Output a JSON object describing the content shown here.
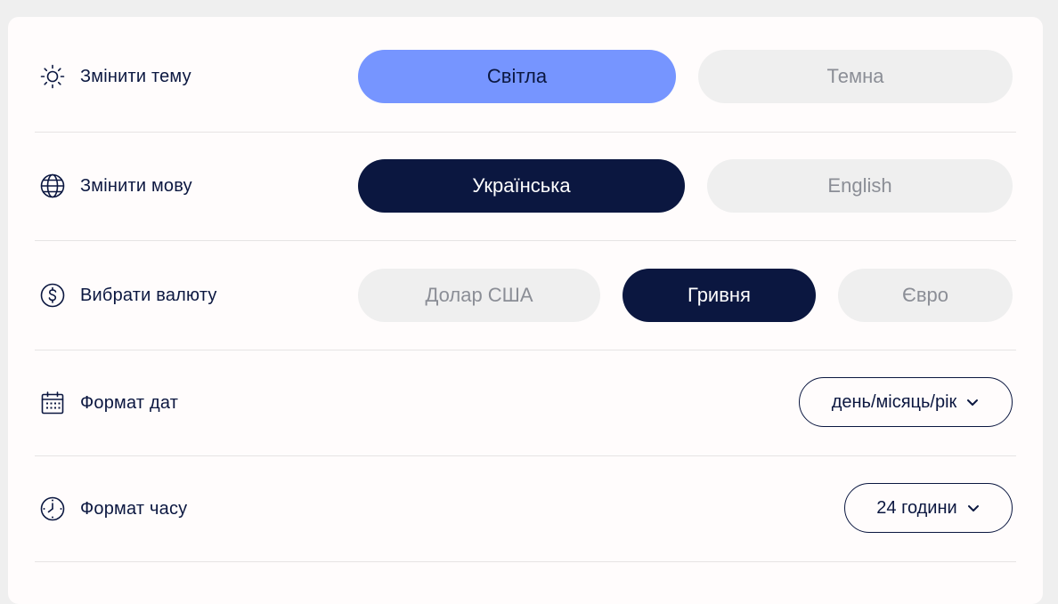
{
  "theme": {
    "label": "Змінити тему",
    "options": [
      "Світла",
      "Темна"
    ],
    "selected": "Світла"
  },
  "language": {
    "label": "Змінити мову",
    "options": [
      "Українська",
      "English"
    ],
    "selected": "Українська"
  },
  "currency": {
    "label": "Вибрати валюту",
    "options": [
      "Долар США",
      "Гривня",
      "Євро"
    ],
    "selected": "Гривня"
  },
  "date_format": {
    "label": "Формат дат",
    "value": "день/місяць/рік"
  },
  "time_format": {
    "label": "Формат часу",
    "value": "24 години"
  },
  "icons": [
    "sun-icon",
    "globe-icon",
    "dollar-circle-icon",
    "calendar-icon",
    "clock-icon",
    "chevron-down-icon"
  ],
  "colors": {
    "accent_light": "#7695ff",
    "accent_dark": "#0b1740",
    "inactive_bg": "#efefef",
    "inactive_text": "#8b8e96",
    "panel_bg": "#fffcfc"
  }
}
